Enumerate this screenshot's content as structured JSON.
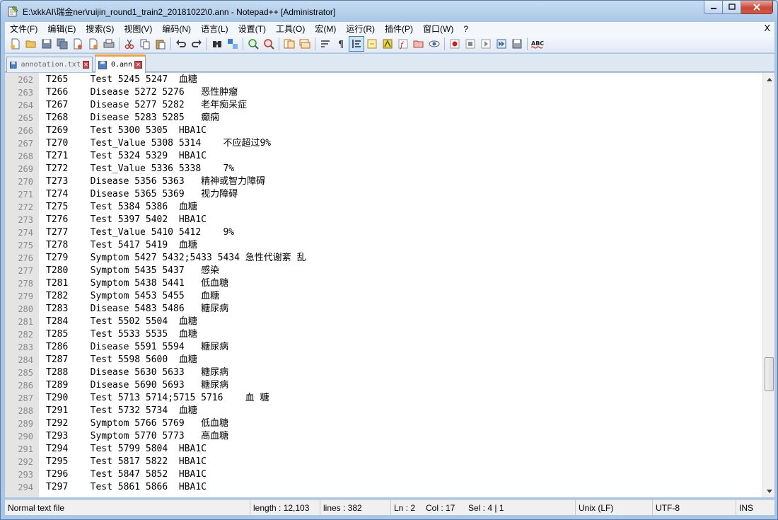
{
  "window": {
    "title": "E:\\xkkAI\\瑞金ner\\ruijin_round1_train2_20181022\\0.ann - Notepad++ [Administrator]"
  },
  "menu": {
    "items": [
      "文件(F)",
      "编辑(E)",
      "搜索(S)",
      "视图(V)",
      "编码(N)",
      "语言(L)",
      "设置(T)",
      "工具(O)",
      "宏(M)",
      "运行(R)",
      "插件(P)",
      "窗口(W)",
      "?"
    ],
    "close_label": "X"
  },
  "tabs": [
    {
      "label": "annotation.txt",
      "active": false
    },
    {
      "label": "0.ann",
      "active": true
    }
  ],
  "editor": {
    "lines": [
      {
        "no": "262",
        "text": "T265    Test 5245 5247  血糖"
      },
      {
        "no": "263",
        "text": "T266    Disease 5272 5276   恶性肿瘤"
      },
      {
        "no": "264",
        "text": "T267    Disease 5277 5282   老年痴呆症"
      },
      {
        "no": "265",
        "text": "T268    Disease 5283 5285   癫痫"
      },
      {
        "no": "266",
        "text": "T269    Test 5300 5305  HBA1C"
      },
      {
        "no": "267",
        "text": "T270    Test_Value 5308 5314    不应超过9%"
      },
      {
        "no": "268",
        "text": "T271    Test 5324 5329  HBA1C"
      },
      {
        "no": "269",
        "text": "T272    Test_Value 5336 5338    7%"
      },
      {
        "no": "270",
        "text": "T273    Disease 5356 5363   精神或智力障碍"
      },
      {
        "no": "271",
        "text": "T274    Disease 5365 5369   视力障碍"
      },
      {
        "no": "272",
        "text": "T275    Test 5384 5386  血糖"
      },
      {
        "no": "273",
        "text": "T276    Test 5397 5402  HBA1C"
      },
      {
        "no": "274",
        "text": "T277    Test_Value 5410 5412    9%"
      },
      {
        "no": "275",
        "text": "T278    Test 5417 5419  血糖"
      },
      {
        "no": "276",
        "text": "T279    Symptom 5427 5432;5433 5434 急性代谢紊 乱"
      },
      {
        "no": "277",
        "text": "T280    Symptom 5435 5437   感染"
      },
      {
        "no": "278",
        "text": "T281    Symptom 5438 5441   低血糖"
      },
      {
        "no": "279",
        "text": "T282    Symptom 5453 5455   血糖"
      },
      {
        "no": "280",
        "text": "T283    Disease 5483 5486   糖尿病"
      },
      {
        "no": "281",
        "text": "T284    Test 5502 5504  血糖"
      },
      {
        "no": "282",
        "text": "T285    Test 5533 5535  血糖"
      },
      {
        "no": "283",
        "text": "T286    Disease 5591 5594   糖尿病"
      },
      {
        "no": "284",
        "text": "T287    Test 5598 5600  血糖"
      },
      {
        "no": "285",
        "text": "T288    Disease 5630 5633   糖尿病"
      },
      {
        "no": "286",
        "text": "T289    Disease 5690 5693   糖尿病"
      },
      {
        "no": "287",
        "text": "T290    Test 5713 5714;5715 5716    血 糖"
      },
      {
        "no": "288",
        "text": "T291    Test 5732 5734  血糖"
      },
      {
        "no": "289",
        "text": "T292    Symptom 5766 5769   低血糖"
      },
      {
        "no": "290",
        "text": "T293    Symptom 5770 5773   高血糖"
      },
      {
        "no": "291",
        "text": "T294    Test 5799 5804  HBA1C"
      },
      {
        "no": "292",
        "text": "T295    Test 5817 5822  HBA1C"
      },
      {
        "no": "293",
        "text": "T296    Test 5847 5852  HBA1C"
      },
      {
        "no": "294",
        "text": "T297    Test 5861 5866  HBA1C"
      }
    ]
  },
  "status": {
    "file_type": "Normal text file",
    "length": "length : 12,103",
    "lines": "lines : 382",
    "ln": "Ln : 2",
    "col": "Col : 17",
    "sel": "Sel : 4 | 1",
    "eol": "Unix (LF)",
    "encoding": "UTF-8",
    "mode": "INS"
  }
}
